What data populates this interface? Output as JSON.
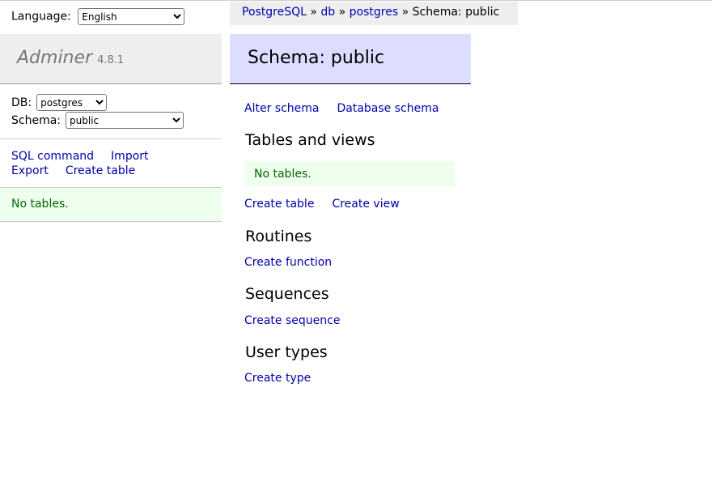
{
  "breadcrumb": {
    "items": [
      "PostgreSQL",
      "db",
      "postgres"
    ],
    "separator": "»",
    "current": "Schema: public"
  },
  "language": {
    "label": "Language:",
    "selected": "English"
  },
  "brand": {
    "name": "Adminer",
    "version": "4.8.1"
  },
  "db_select": {
    "label": "DB:",
    "selected": "postgres"
  },
  "schema_select": {
    "label": "Schema:",
    "selected": "public"
  },
  "menu": {
    "sql_command": "SQL command",
    "import": "Import",
    "export": "Export",
    "create_table": "Create table"
  },
  "sidebar_message": "No tables.",
  "page_title": "Schema: public",
  "schema_links": {
    "alter_schema": "Alter schema",
    "database_schema": "Database schema"
  },
  "sections": {
    "tables": {
      "heading": "Tables and views",
      "message": "No tables.",
      "create_table": "Create table",
      "create_view": "Create view"
    },
    "routines": {
      "heading": "Routines",
      "create_function": "Create function"
    },
    "sequences": {
      "heading": "Sequences",
      "create_sequence": "Create sequence"
    },
    "user_types": {
      "heading": "User types",
      "create_type": "Create type"
    }
  },
  "colors": {
    "link": "#0000aa",
    "header_bg": "#eeeeee",
    "title_bg": "#ddddff",
    "message_bg": "#eeffee",
    "message_text": "#006600"
  }
}
